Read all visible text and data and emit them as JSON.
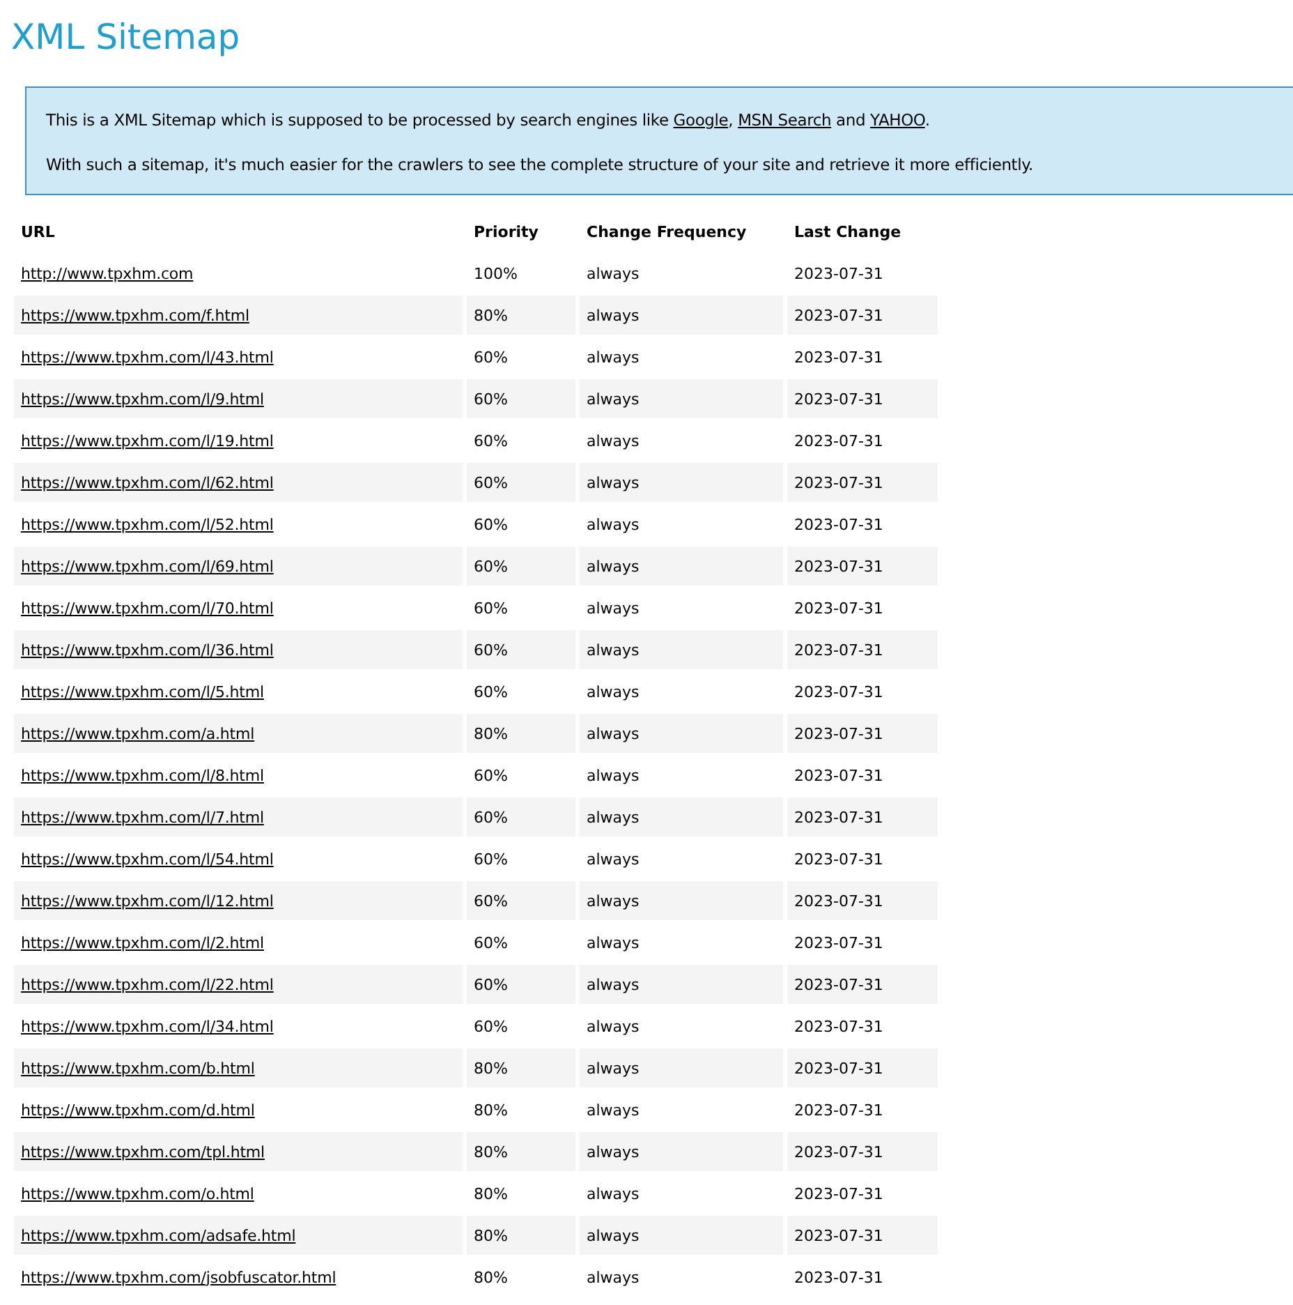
{
  "title": "XML Sitemap",
  "intro": {
    "paragraphs": [
      [
        {
          "kind": "text",
          "text": "This is a XML Sitemap which is supposed to be processed by search engines like "
        },
        {
          "kind": "link",
          "text": "Google"
        },
        {
          "kind": "text",
          "text": ", "
        },
        {
          "kind": "link",
          "text": "MSN Search"
        },
        {
          "kind": "text",
          "text": " and "
        },
        {
          "kind": "link",
          "text": "YAHOO"
        },
        {
          "kind": "text",
          "text": "."
        }
      ],
      [
        {
          "kind": "text",
          "text": "With such a sitemap, it's much easier for the crawlers to see the complete structure of your site and retrieve it more efficiently."
        }
      ]
    ]
  },
  "table": {
    "columns": [
      "URL",
      "Priority",
      "Change Frequency",
      "Last Change"
    ],
    "rows": [
      {
        "url": "http://www.tpxhm.com",
        "priority": "100%",
        "change_frequency": "always",
        "last_change": "2023-07-31"
      },
      {
        "url": "https://www.tpxhm.com/f.html",
        "priority": "80%",
        "change_frequency": "always",
        "last_change": "2023-07-31"
      },
      {
        "url": "https://www.tpxhm.com/l/43.html",
        "priority": "60%",
        "change_frequency": "always",
        "last_change": "2023-07-31"
      },
      {
        "url": "https://www.tpxhm.com/l/9.html",
        "priority": "60%",
        "change_frequency": "always",
        "last_change": "2023-07-31"
      },
      {
        "url": "https://www.tpxhm.com/l/19.html",
        "priority": "60%",
        "change_frequency": "always",
        "last_change": "2023-07-31"
      },
      {
        "url": "https://www.tpxhm.com/l/62.html",
        "priority": "60%",
        "change_frequency": "always",
        "last_change": "2023-07-31"
      },
      {
        "url": "https://www.tpxhm.com/l/52.html",
        "priority": "60%",
        "change_frequency": "always",
        "last_change": "2023-07-31"
      },
      {
        "url": "https://www.tpxhm.com/l/69.html",
        "priority": "60%",
        "change_frequency": "always",
        "last_change": "2023-07-31"
      },
      {
        "url": "https://www.tpxhm.com/l/70.html",
        "priority": "60%",
        "change_frequency": "always",
        "last_change": "2023-07-31"
      },
      {
        "url": "https://www.tpxhm.com/l/36.html",
        "priority": "60%",
        "change_frequency": "always",
        "last_change": "2023-07-31"
      },
      {
        "url": "https://www.tpxhm.com/l/5.html",
        "priority": "60%",
        "change_frequency": "always",
        "last_change": "2023-07-31"
      },
      {
        "url": "https://www.tpxhm.com/a.html",
        "priority": "80%",
        "change_frequency": "always",
        "last_change": "2023-07-31"
      },
      {
        "url": "https://www.tpxhm.com/l/8.html",
        "priority": "60%",
        "change_frequency": "always",
        "last_change": "2023-07-31"
      },
      {
        "url": "https://www.tpxhm.com/l/7.html",
        "priority": "60%",
        "change_frequency": "always",
        "last_change": "2023-07-31"
      },
      {
        "url": "https://www.tpxhm.com/l/54.html",
        "priority": "60%",
        "change_frequency": "always",
        "last_change": "2023-07-31"
      },
      {
        "url": "https://www.tpxhm.com/l/12.html",
        "priority": "60%",
        "change_frequency": "always",
        "last_change": "2023-07-31"
      },
      {
        "url": "https://www.tpxhm.com/l/2.html",
        "priority": "60%",
        "change_frequency": "always",
        "last_change": "2023-07-31"
      },
      {
        "url": "https://www.tpxhm.com/l/22.html",
        "priority": "60%",
        "change_frequency": "always",
        "last_change": "2023-07-31"
      },
      {
        "url": "https://www.tpxhm.com/l/34.html",
        "priority": "60%",
        "change_frequency": "always",
        "last_change": "2023-07-31"
      },
      {
        "url": "https://www.tpxhm.com/b.html",
        "priority": "80%",
        "change_frequency": "always",
        "last_change": "2023-07-31"
      },
      {
        "url": "https://www.tpxhm.com/d.html",
        "priority": "80%",
        "change_frequency": "always",
        "last_change": "2023-07-31"
      },
      {
        "url": "https://www.tpxhm.com/tpl.html",
        "priority": "80%",
        "change_frequency": "always",
        "last_change": "2023-07-31"
      },
      {
        "url": "https://www.tpxhm.com/o.html",
        "priority": "80%",
        "change_frequency": "always",
        "last_change": "2023-07-31"
      },
      {
        "url": "https://www.tpxhm.com/adsafe.html",
        "priority": "80%",
        "change_frequency": "always",
        "last_change": "2023-07-31"
      },
      {
        "url": "https://www.tpxhm.com/jsobfuscator.html",
        "priority": "80%",
        "change_frequency": "always",
        "last_change": "2023-07-31"
      }
    ]
  }
}
